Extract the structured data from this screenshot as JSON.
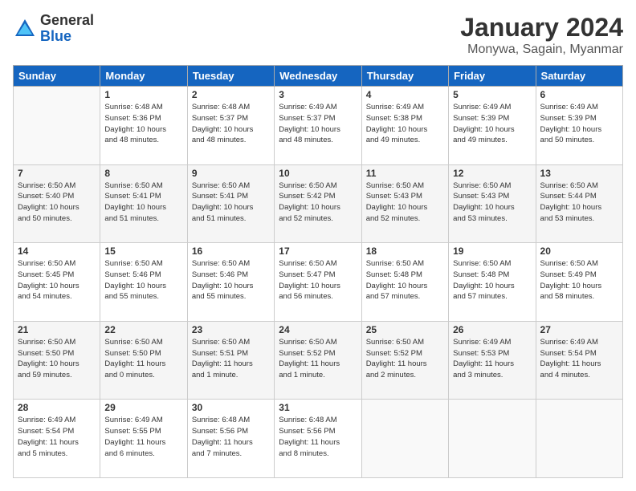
{
  "logo": {
    "general": "General",
    "blue": "Blue"
  },
  "title": "January 2024",
  "location": "Monywa, Sagain, Myanmar",
  "days_header": [
    "Sunday",
    "Monday",
    "Tuesday",
    "Wednesday",
    "Thursday",
    "Friday",
    "Saturday"
  ],
  "weeks": [
    [
      {
        "day": "",
        "info": ""
      },
      {
        "day": "1",
        "info": "Sunrise: 6:48 AM\nSunset: 5:36 PM\nDaylight: 10 hours\nand 48 minutes."
      },
      {
        "day": "2",
        "info": "Sunrise: 6:48 AM\nSunset: 5:37 PM\nDaylight: 10 hours\nand 48 minutes."
      },
      {
        "day": "3",
        "info": "Sunrise: 6:49 AM\nSunset: 5:37 PM\nDaylight: 10 hours\nand 48 minutes."
      },
      {
        "day": "4",
        "info": "Sunrise: 6:49 AM\nSunset: 5:38 PM\nDaylight: 10 hours\nand 49 minutes."
      },
      {
        "day": "5",
        "info": "Sunrise: 6:49 AM\nSunset: 5:39 PM\nDaylight: 10 hours\nand 49 minutes."
      },
      {
        "day": "6",
        "info": "Sunrise: 6:49 AM\nSunset: 5:39 PM\nDaylight: 10 hours\nand 50 minutes."
      }
    ],
    [
      {
        "day": "7",
        "info": "Sunrise: 6:50 AM\nSunset: 5:40 PM\nDaylight: 10 hours\nand 50 minutes."
      },
      {
        "day": "8",
        "info": "Sunrise: 6:50 AM\nSunset: 5:41 PM\nDaylight: 10 hours\nand 51 minutes."
      },
      {
        "day": "9",
        "info": "Sunrise: 6:50 AM\nSunset: 5:41 PM\nDaylight: 10 hours\nand 51 minutes."
      },
      {
        "day": "10",
        "info": "Sunrise: 6:50 AM\nSunset: 5:42 PM\nDaylight: 10 hours\nand 52 minutes."
      },
      {
        "day": "11",
        "info": "Sunrise: 6:50 AM\nSunset: 5:43 PM\nDaylight: 10 hours\nand 52 minutes."
      },
      {
        "day": "12",
        "info": "Sunrise: 6:50 AM\nSunset: 5:43 PM\nDaylight: 10 hours\nand 53 minutes."
      },
      {
        "day": "13",
        "info": "Sunrise: 6:50 AM\nSunset: 5:44 PM\nDaylight: 10 hours\nand 53 minutes."
      }
    ],
    [
      {
        "day": "14",
        "info": "Sunrise: 6:50 AM\nSunset: 5:45 PM\nDaylight: 10 hours\nand 54 minutes."
      },
      {
        "day": "15",
        "info": "Sunrise: 6:50 AM\nSunset: 5:46 PM\nDaylight: 10 hours\nand 55 minutes."
      },
      {
        "day": "16",
        "info": "Sunrise: 6:50 AM\nSunset: 5:46 PM\nDaylight: 10 hours\nand 55 minutes."
      },
      {
        "day": "17",
        "info": "Sunrise: 6:50 AM\nSunset: 5:47 PM\nDaylight: 10 hours\nand 56 minutes."
      },
      {
        "day": "18",
        "info": "Sunrise: 6:50 AM\nSunset: 5:48 PM\nDaylight: 10 hours\nand 57 minutes."
      },
      {
        "day": "19",
        "info": "Sunrise: 6:50 AM\nSunset: 5:48 PM\nDaylight: 10 hours\nand 57 minutes."
      },
      {
        "day": "20",
        "info": "Sunrise: 6:50 AM\nSunset: 5:49 PM\nDaylight: 10 hours\nand 58 minutes."
      }
    ],
    [
      {
        "day": "21",
        "info": "Sunrise: 6:50 AM\nSunset: 5:50 PM\nDaylight: 10 hours\nand 59 minutes."
      },
      {
        "day": "22",
        "info": "Sunrise: 6:50 AM\nSunset: 5:50 PM\nDaylight: 11 hours\nand 0 minutes."
      },
      {
        "day": "23",
        "info": "Sunrise: 6:50 AM\nSunset: 5:51 PM\nDaylight: 11 hours\nand 1 minute."
      },
      {
        "day": "24",
        "info": "Sunrise: 6:50 AM\nSunset: 5:52 PM\nDaylight: 11 hours\nand 1 minute."
      },
      {
        "day": "25",
        "info": "Sunrise: 6:50 AM\nSunset: 5:52 PM\nDaylight: 11 hours\nand 2 minutes."
      },
      {
        "day": "26",
        "info": "Sunrise: 6:49 AM\nSunset: 5:53 PM\nDaylight: 11 hours\nand 3 minutes."
      },
      {
        "day": "27",
        "info": "Sunrise: 6:49 AM\nSunset: 5:54 PM\nDaylight: 11 hours\nand 4 minutes."
      }
    ],
    [
      {
        "day": "28",
        "info": "Sunrise: 6:49 AM\nSunset: 5:54 PM\nDaylight: 11 hours\nand 5 minutes."
      },
      {
        "day": "29",
        "info": "Sunrise: 6:49 AM\nSunset: 5:55 PM\nDaylight: 11 hours\nand 6 minutes."
      },
      {
        "day": "30",
        "info": "Sunrise: 6:48 AM\nSunset: 5:56 PM\nDaylight: 11 hours\nand 7 minutes."
      },
      {
        "day": "31",
        "info": "Sunrise: 6:48 AM\nSunset: 5:56 PM\nDaylight: 11 hours\nand 8 minutes."
      },
      {
        "day": "",
        "info": ""
      },
      {
        "day": "",
        "info": ""
      },
      {
        "day": "",
        "info": ""
      }
    ]
  ]
}
